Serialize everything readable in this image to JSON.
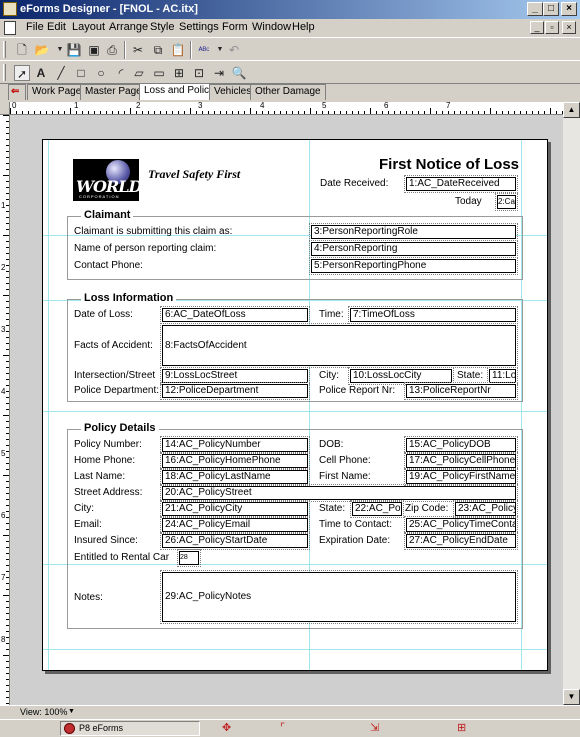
{
  "window": {
    "title": "eForms Designer - [FNOL - AC.itx]"
  },
  "menu": {
    "items": [
      "File",
      "Edit",
      "Layout",
      "Arrange",
      "Style",
      "Settings",
      "Form",
      "Window",
      "Help"
    ]
  },
  "tabs": [
    "Work Page",
    "Master Page",
    "Loss and Policy",
    "Vehicles",
    "Other Damage"
  ],
  "active_tab": "Loss and Policy",
  "form": {
    "logo_text": "WORLD",
    "logo_sub": "CORPORATION",
    "company": "Travel Safety First",
    "title": "First Notice of Loss",
    "date_received_label": "Date Received:",
    "date_received_field": "1:AC_DateReceived",
    "today_label": "Today",
    "today_field": "2:Ca",
    "claimant": {
      "title": "Claimant",
      "role_label": "Claimant is submitting this claim as:",
      "role_field": "3:PersonReportingRole",
      "name_label": "Name of person reporting claim:",
      "name_field": "4:PersonReporting",
      "phone_label": "Contact Phone:",
      "phone_field": "5:PersonReportingPhone"
    },
    "loss": {
      "title": "Loss Information",
      "date_label": "Date of Loss:",
      "date_field": "6:AC_DateOfLoss",
      "time_label": "Time:",
      "time_field": "7:TimeOfLoss",
      "facts_label": "Facts of Accident:",
      "facts_field": "8:FactsOfAccident",
      "street_label": "Intersection/Street",
      "street_field": "9:LossLocStreet",
      "city_label": "City:",
      "city_field": "10:LossLocCity",
      "state_label": "State:",
      "state_field": "11:Lo",
      "police_label": "Police Department:",
      "police_field": "12:PoliceDepartment",
      "report_label": "Police Report Nr:",
      "report_field": "13:PoliceReportNr"
    },
    "policy": {
      "title": "Policy Details",
      "number_label": "Policy Number:",
      "number_field": "14:AC_PolicyNumber",
      "dob_label": "DOB:",
      "dob_field": "15:AC_PolicyDOB",
      "home_label": "Home Phone:",
      "home_field": "16:AC_PolicyHomePhone",
      "cell_label": "Cell Phone:",
      "cell_field": "17:AC_PolicyCellPhone",
      "last_label": "Last Name:",
      "last_field": "18:AC_PolicyLastName",
      "first_label": "First Name:",
      "first_field": "19:AC_PolicyFirstName",
      "street_label": "Street Address:",
      "street_field": "20:AC_PolicyStreet",
      "city_label": "City:",
      "city_field": "21:AC_PolicyCity",
      "state_label": "State:",
      "state_field": "22:AC_Poli",
      "zip_label": "Zip Code:",
      "zip_field": "23:AC_Policy",
      "email_label": "Email:",
      "email_field": "24:AC_PolicyEmail",
      "contact_label": "Time to Contact:",
      "contact_field": "25:AC_PolicyTimeConta",
      "insured_label": "Insured Since:",
      "insured_field": "26:AC_PolicyStartDate",
      "expiration_label": "Expiration Date:",
      "expiration_field": "27:AC_PolicyEndDate",
      "rental_label": "Entitled to Rental Car",
      "rental_field": "28",
      "notes_label": "Notes:",
      "notes_field": "29:AC_PolicyNotes"
    }
  },
  "ruler": {
    "h": [
      "0",
      "1",
      "2",
      "3",
      "4",
      "5",
      "6",
      "7"
    ],
    "v": [
      "1",
      "2",
      "3",
      "4",
      "5",
      "6",
      "7",
      "8"
    ]
  },
  "status": {
    "view": "View: 100%"
  },
  "taskbar": {
    "app": "P8 eForms"
  }
}
